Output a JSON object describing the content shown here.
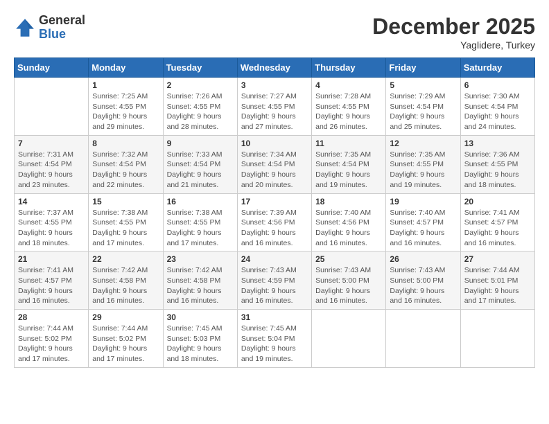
{
  "header": {
    "logo_line1": "General",
    "logo_line2": "Blue",
    "month": "December 2025",
    "location": "Yaglidere, Turkey"
  },
  "weekdays": [
    "Sunday",
    "Monday",
    "Tuesday",
    "Wednesday",
    "Thursday",
    "Friday",
    "Saturday"
  ],
  "weeks": [
    [
      {
        "day": "",
        "info": ""
      },
      {
        "day": "1",
        "info": "Sunrise: 7:25 AM\nSunset: 4:55 PM\nDaylight: 9 hours\nand 29 minutes."
      },
      {
        "day": "2",
        "info": "Sunrise: 7:26 AM\nSunset: 4:55 PM\nDaylight: 9 hours\nand 28 minutes."
      },
      {
        "day": "3",
        "info": "Sunrise: 7:27 AM\nSunset: 4:55 PM\nDaylight: 9 hours\nand 27 minutes."
      },
      {
        "day": "4",
        "info": "Sunrise: 7:28 AM\nSunset: 4:55 PM\nDaylight: 9 hours\nand 26 minutes."
      },
      {
        "day": "5",
        "info": "Sunrise: 7:29 AM\nSunset: 4:54 PM\nDaylight: 9 hours\nand 25 minutes."
      },
      {
        "day": "6",
        "info": "Sunrise: 7:30 AM\nSunset: 4:54 PM\nDaylight: 9 hours\nand 24 minutes."
      }
    ],
    [
      {
        "day": "7",
        "info": "Sunrise: 7:31 AM\nSunset: 4:54 PM\nDaylight: 9 hours\nand 23 minutes."
      },
      {
        "day": "8",
        "info": "Sunrise: 7:32 AM\nSunset: 4:54 PM\nDaylight: 9 hours\nand 22 minutes."
      },
      {
        "day": "9",
        "info": "Sunrise: 7:33 AM\nSunset: 4:54 PM\nDaylight: 9 hours\nand 21 minutes."
      },
      {
        "day": "10",
        "info": "Sunrise: 7:34 AM\nSunset: 4:54 PM\nDaylight: 9 hours\nand 20 minutes."
      },
      {
        "day": "11",
        "info": "Sunrise: 7:35 AM\nSunset: 4:54 PM\nDaylight: 9 hours\nand 19 minutes."
      },
      {
        "day": "12",
        "info": "Sunrise: 7:35 AM\nSunset: 4:55 PM\nDaylight: 9 hours\nand 19 minutes."
      },
      {
        "day": "13",
        "info": "Sunrise: 7:36 AM\nSunset: 4:55 PM\nDaylight: 9 hours\nand 18 minutes."
      }
    ],
    [
      {
        "day": "14",
        "info": "Sunrise: 7:37 AM\nSunset: 4:55 PM\nDaylight: 9 hours\nand 18 minutes."
      },
      {
        "day": "15",
        "info": "Sunrise: 7:38 AM\nSunset: 4:55 PM\nDaylight: 9 hours\nand 17 minutes."
      },
      {
        "day": "16",
        "info": "Sunrise: 7:38 AM\nSunset: 4:55 PM\nDaylight: 9 hours\nand 17 minutes."
      },
      {
        "day": "17",
        "info": "Sunrise: 7:39 AM\nSunset: 4:56 PM\nDaylight: 9 hours\nand 16 minutes."
      },
      {
        "day": "18",
        "info": "Sunrise: 7:40 AM\nSunset: 4:56 PM\nDaylight: 9 hours\nand 16 minutes."
      },
      {
        "day": "19",
        "info": "Sunrise: 7:40 AM\nSunset: 4:57 PM\nDaylight: 9 hours\nand 16 minutes."
      },
      {
        "day": "20",
        "info": "Sunrise: 7:41 AM\nSunset: 4:57 PM\nDaylight: 9 hours\nand 16 minutes."
      }
    ],
    [
      {
        "day": "21",
        "info": "Sunrise: 7:41 AM\nSunset: 4:57 PM\nDaylight: 9 hours\nand 16 minutes."
      },
      {
        "day": "22",
        "info": "Sunrise: 7:42 AM\nSunset: 4:58 PM\nDaylight: 9 hours\nand 16 minutes."
      },
      {
        "day": "23",
        "info": "Sunrise: 7:42 AM\nSunset: 4:58 PM\nDaylight: 9 hours\nand 16 minutes."
      },
      {
        "day": "24",
        "info": "Sunrise: 7:43 AM\nSunset: 4:59 PM\nDaylight: 9 hours\nand 16 minutes."
      },
      {
        "day": "25",
        "info": "Sunrise: 7:43 AM\nSunset: 5:00 PM\nDaylight: 9 hours\nand 16 minutes."
      },
      {
        "day": "26",
        "info": "Sunrise: 7:43 AM\nSunset: 5:00 PM\nDaylight: 9 hours\nand 16 minutes."
      },
      {
        "day": "27",
        "info": "Sunrise: 7:44 AM\nSunset: 5:01 PM\nDaylight: 9 hours\nand 17 minutes."
      }
    ],
    [
      {
        "day": "28",
        "info": "Sunrise: 7:44 AM\nSunset: 5:02 PM\nDaylight: 9 hours\nand 17 minutes."
      },
      {
        "day": "29",
        "info": "Sunrise: 7:44 AM\nSunset: 5:02 PM\nDaylight: 9 hours\nand 17 minutes."
      },
      {
        "day": "30",
        "info": "Sunrise: 7:45 AM\nSunset: 5:03 PM\nDaylight: 9 hours\nand 18 minutes."
      },
      {
        "day": "31",
        "info": "Sunrise: 7:45 AM\nSunset: 5:04 PM\nDaylight: 9 hours\nand 19 minutes."
      },
      {
        "day": "",
        "info": ""
      },
      {
        "day": "",
        "info": ""
      },
      {
        "day": "",
        "info": ""
      }
    ]
  ]
}
